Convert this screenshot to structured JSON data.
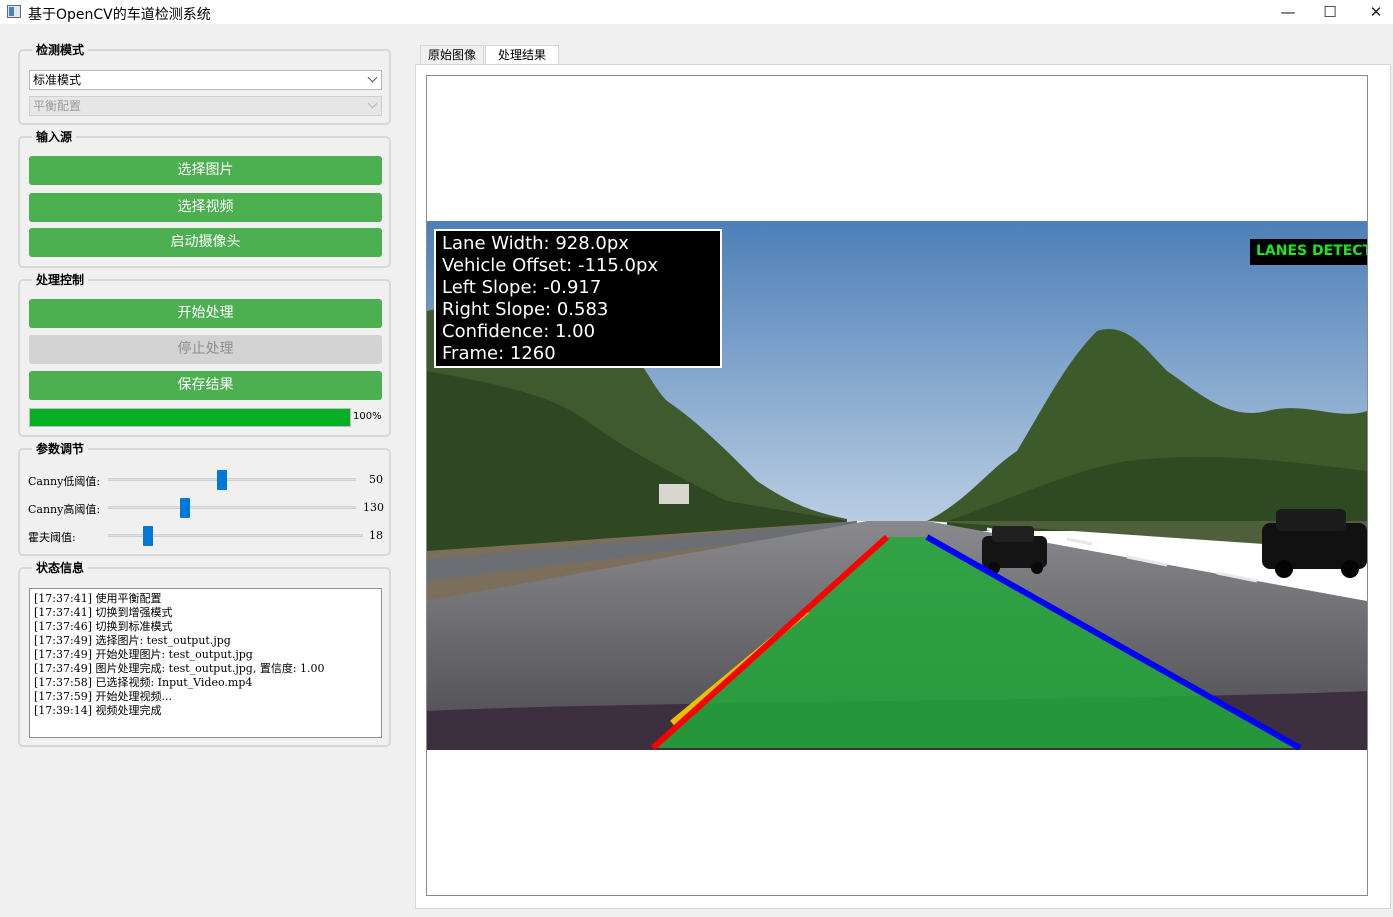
{
  "window": {
    "title": "基于OpenCV的车道检测系统",
    "minimize_icon": "minimize-icon",
    "maximize_icon": "maximize-icon",
    "close_icon": "close-icon"
  },
  "detection_mode": {
    "title": "检测模式",
    "mode_value": "标准模式",
    "config_value": "平衡配置"
  },
  "input_source": {
    "title": "输入源",
    "select_image": "选择图片",
    "select_video": "选择视频",
    "start_camera": "启动摄像头"
  },
  "processing": {
    "title": "处理控制",
    "start": "开始处理",
    "stop": "停止处理",
    "save": "保存结果",
    "progress": 100,
    "progress_label": "100%"
  },
  "params": {
    "title": "参数调节",
    "sliders": [
      {
        "label": "Canny低阈值:",
        "value": "50"
      },
      {
        "label": "Canny高阈值:",
        "value": "130"
      },
      {
        "label": "霍夫阈值:",
        "value": "18"
      }
    ]
  },
  "status": {
    "title": "状态信息",
    "logs": [
      "[17:37:41] 使用平衡配置",
      "[17:37:41] 切换到增强模式",
      "[17:37:46] 切换到标准模式",
      "[17:37:49] 选择图片: test_output.jpg",
      "[17:37:49] 开始处理图片: test_output.jpg",
      "[17:37:49] 图片处理完成: test_output.jpg, 置信度: 1.00",
      "[17:37:58] 已选择视频: Input_Video.mp4",
      "[17:37:59] 开始处理视频...",
      "[17:39:14] 视频处理完成"
    ]
  },
  "tabs": [
    {
      "label": "原始图像"
    },
    {
      "label": "处理结果"
    }
  ],
  "result": {
    "stats": [
      "Lane Width: 928.0px",
      "Vehicle Offset: -115.0px",
      "Left Slope: -0.917",
      "Right Slope: 0.583",
      "Confidence: 1.00",
      "Frame: 1260"
    ],
    "badge": "LANES DETECTED",
    "colors": {
      "left_lane": "#ff0000",
      "right_lane": "#0000ff",
      "lane_area": "#22a83a",
      "badge_text": "#1ee61e",
      "button_green": "#4caf50",
      "progress_green": "#06b025",
      "slider_handle": "#0078d7"
    }
  }
}
